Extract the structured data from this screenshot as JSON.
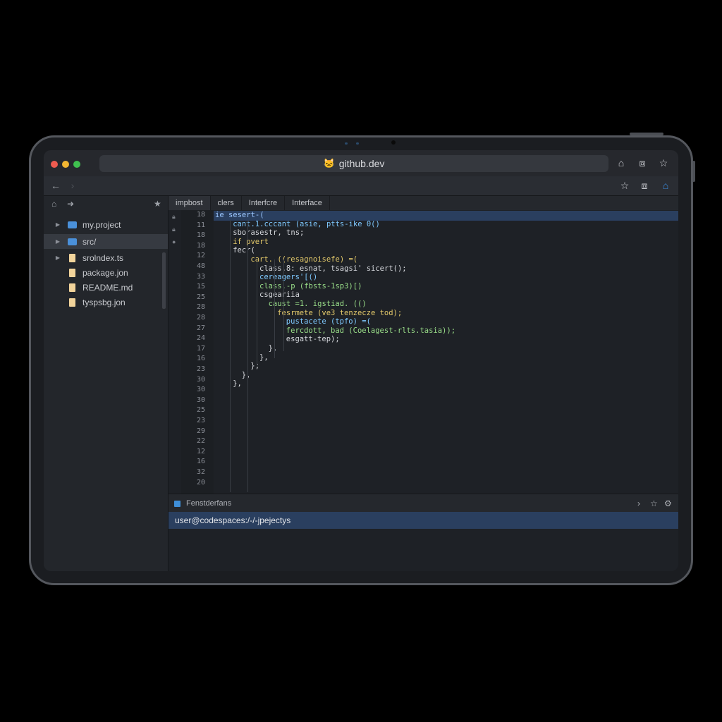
{
  "browser": {
    "url": "github.dev",
    "url_icon": "github-cat-icon",
    "window_controls": [
      "close",
      "minimize",
      "maximize"
    ],
    "colors": {
      "close": "#ee5b50",
      "minimize": "#f2b632",
      "maximize": "#3fc04f",
      "accent": "#3b8de0"
    }
  },
  "sidebar": {
    "items": [
      {
        "label": "my.project",
        "type": "folder"
      },
      {
        "label": "src/",
        "type": "folder",
        "selected": true
      },
      {
        "label": "srolndex.ts",
        "type": "file"
      },
      {
        "label": "package.jon",
        "type": "file"
      },
      {
        "label": "README.md",
        "type": "file"
      },
      {
        "label": "tyspsbg.jon",
        "type": "file"
      }
    ]
  },
  "editor": {
    "tabs": [
      "impbost",
      "clers",
      "Interfcre",
      "Interface"
    ],
    "line_numbers": [
      "18",
      "11",
      "18",
      "18",
      "12",
      "48",
      "33",
      "15",
      "25",
      "28",
      "28",
      "27",
      "24",
      "17",
      "16",
      "23",
      "30",
      "30",
      "30",
      "25",
      "23",
      "29",
      "22",
      "12",
      "16",
      "32",
      "20"
    ],
    "code_lines": [
      {
        "text": "ie sesert-(",
        "indent": 0,
        "color": "#9cc7ff",
        "highlight": true
      },
      {
        "text": "cant.1.cccant (asie, ptts-ike 0()",
        "indent": 4,
        "color": "#7fc9ff"
      },
      {
        "text": "sborasestr, tns;",
        "indent": 4,
        "color": "#d7d9de"
      },
      {
        "text": "if pvert",
        "indent": 4,
        "color": "#e2c86a"
      },
      {
        "text": "fecr(",
        "indent": 4,
        "color": "#d7d9de"
      },
      {
        "text": "cart. ((resagnoisefe) =(",
        "indent": 8,
        "color": "#e2c86a"
      },
      {
        "text": "class.8: esnat, tsagsi' sicert();",
        "indent": 10,
        "color": "#d7d9de"
      },
      {
        "text": "cereagers'[()",
        "indent": 10,
        "color": "#7fc9ff"
      },
      {
        "text": "class.-p (fbsts-1sp3)[)",
        "indent": 10,
        "color": "#9be08a"
      },
      {
        "text": "csgeariia",
        "indent": 10,
        "color": "#d7d9de"
      },
      {
        "text": "caust =1. igstiad. (()",
        "indent": 12,
        "color": "#9be08a"
      },
      {
        "text": "fesrmete (ve3 tenzecze tod);",
        "indent": 14,
        "color": "#e2c86a"
      },
      {
        "text": "pustacete (tpfo) =(",
        "indent": 16,
        "color": "#7fc9ff"
      },
      {
        "text": "fercdott, bad (Coelagest-rlts.tasia));",
        "indent": 16,
        "color": "#9be08a"
      },
      {
        "text": "esgatt-tep);",
        "indent": 16,
        "color": "#d7d9de"
      },
      {
        "text": "},",
        "indent": 12,
        "color": "#d7d9de"
      },
      {
        "text": "},",
        "indent": 10,
        "color": "#d7d9de"
      },
      {
        "text": "};",
        "indent": 8,
        "color": "#d7d9de"
      },
      {
        "text": "},",
        "indent": 6,
        "color": "#d7d9de"
      },
      {
        "text": "},",
        "indent": 4,
        "color": "#d7d9de"
      }
    ]
  },
  "panel": {
    "title": "Fenstderfans",
    "terminal_line": "user@codespaces:/-/-jpejectys"
  }
}
